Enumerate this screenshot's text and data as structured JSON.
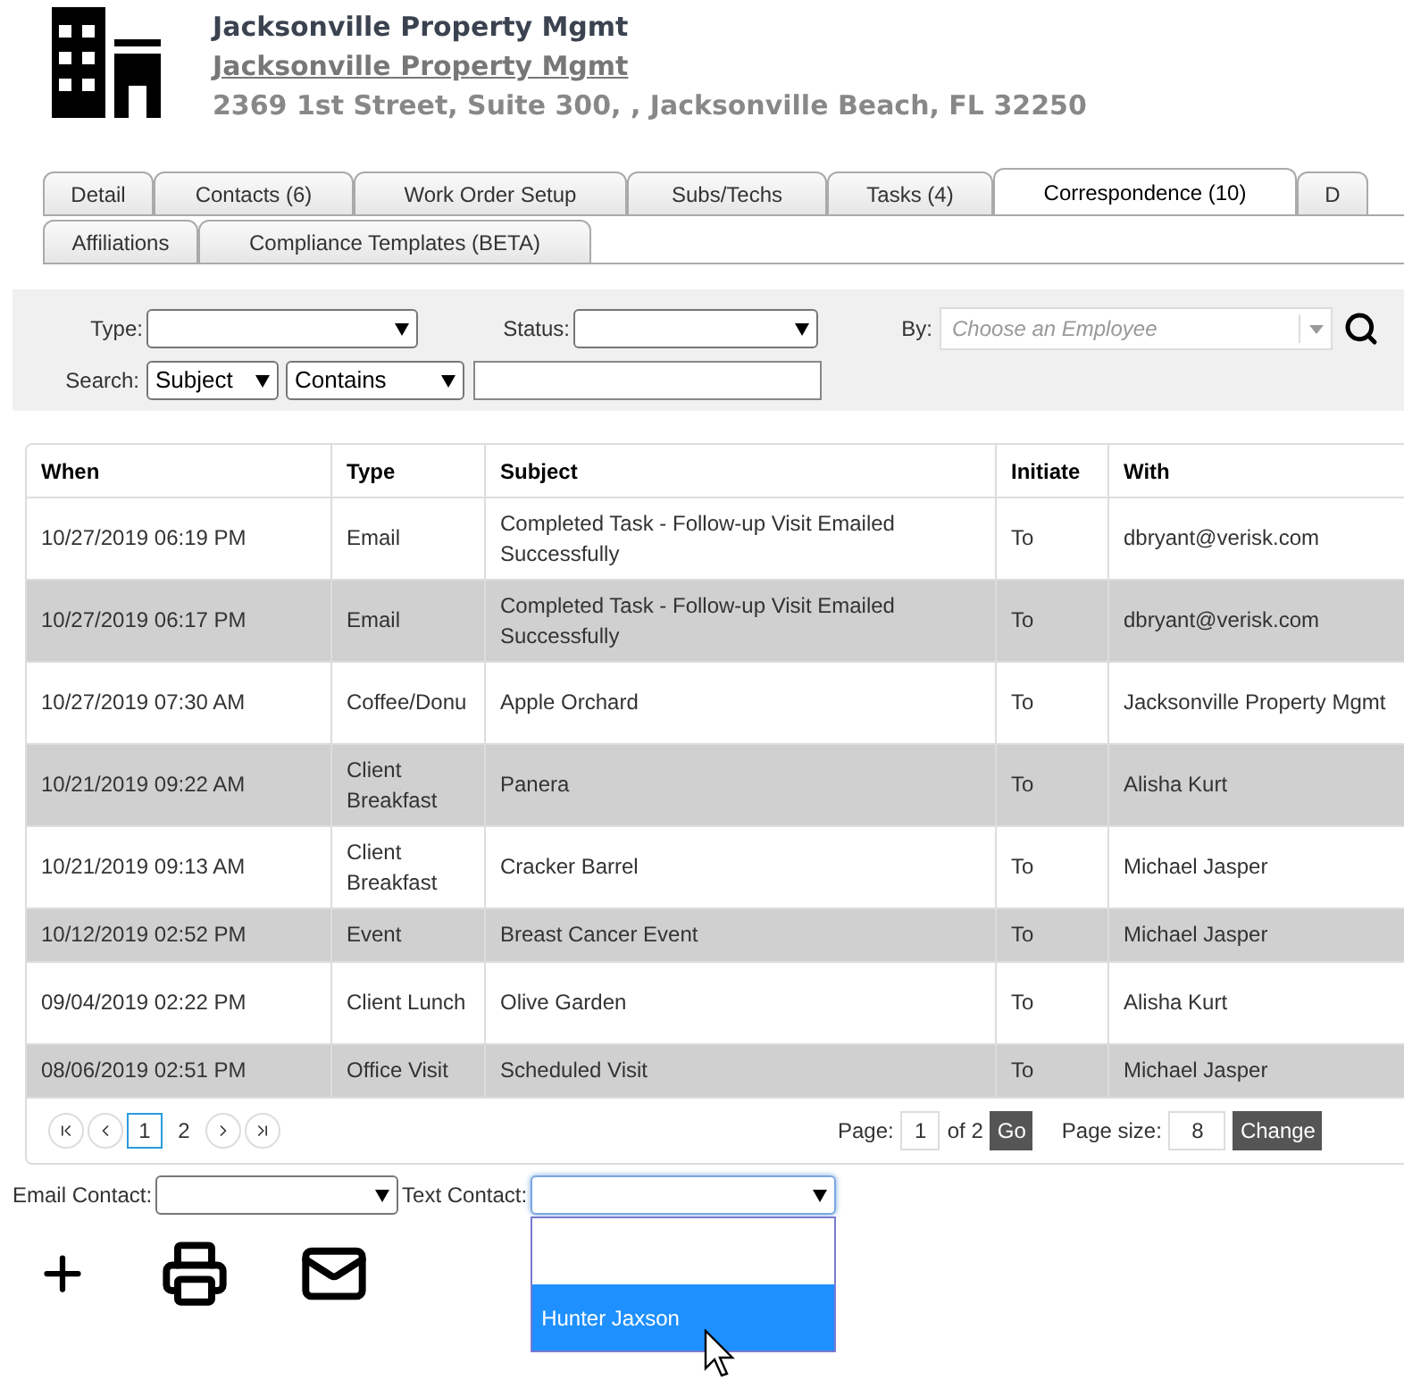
{
  "header": {
    "title": "Jacksonville Property Mgmt",
    "link": "Jacksonville Property Mgmt",
    "address": "2369 1st Street, Suite 300, , Jacksonville Beach, FL 32250"
  },
  "tab_rows": [
    [
      {
        "label": "Detail",
        "selected": false
      },
      {
        "label": "Contacts (6)",
        "selected": false
      },
      {
        "label": "Work Order Setup",
        "selected": false
      },
      {
        "label": "Subs/Techs",
        "selected": false
      },
      {
        "label": "Tasks (4)",
        "selected": false
      },
      {
        "label": "Correspondence (10)",
        "selected": true
      },
      {
        "label": "D",
        "selected": false
      }
    ],
    [
      {
        "label": "Affiliations",
        "selected": false
      },
      {
        "label": "Compliance Templates (BETA)",
        "selected": false
      }
    ]
  ],
  "filters": {
    "type_label": "Type:",
    "status_label": "Status:",
    "by_label": "By:",
    "by_placeholder": "Choose an Employee",
    "search_label": "Search:",
    "search_field": "Subject",
    "search_op": "Contains"
  },
  "table": {
    "columns": [
      "When",
      "Type",
      "Subject",
      "Initiate",
      "With"
    ],
    "rows": [
      [
        "10/27/2019 06:19 PM",
        "Email",
        "Completed Task - Follow-up Visit Emailed Successfully",
        "To",
        "dbryant@verisk.com"
      ],
      [
        "10/27/2019 06:17 PM",
        "Email",
        "Completed Task - Follow-up Visit Emailed Successfully",
        "To",
        "dbryant@verisk.com"
      ],
      [
        "10/27/2019 07:30 AM",
        "Coffee/Donu",
        "Apple Orchard",
        "To",
        "Jacksonville Property Mgmt"
      ],
      [
        "10/21/2019 09:22 AM",
        "Client Breakfast",
        "Panera",
        "To",
        "Alisha Kurt"
      ],
      [
        "10/21/2019 09:13 AM",
        "Client Breakfast",
        "Cracker Barrel",
        "To",
        "Michael Jasper"
      ],
      [
        "10/12/2019 02:52 PM",
        "Event",
        "Breast Cancer Event",
        "To",
        "Michael Jasper"
      ],
      [
        "09/04/2019 02:22 PM",
        "Client Lunch",
        "Olive Garden",
        "To",
        "Alisha Kurt"
      ],
      [
        "08/06/2019 02:51 PM",
        "Office Visit",
        "Scheduled Visit",
        "To",
        "Michael Jasper"
      ]
    ]
  },
  "pager": {
    "pages": [
      {
        "label": "1",
        "selected": true
      },
      {
        "label": "2",
        "selected": false
      }
    ],
    "page_label": "Page:",
    "page": "1",
    "of": "of 2",
    "go": "Go",
    "size_label": "Page size:",
    "size": "8",
    "change": "Change"
  },
  "contacts": {
    "email_label": "Email Contact:",
    "text_label": "Text Contact:",
    "text_options": [
      {
        "label": "Hunter Jaxson",
        "selected": true
      }
    ]
  }
}
